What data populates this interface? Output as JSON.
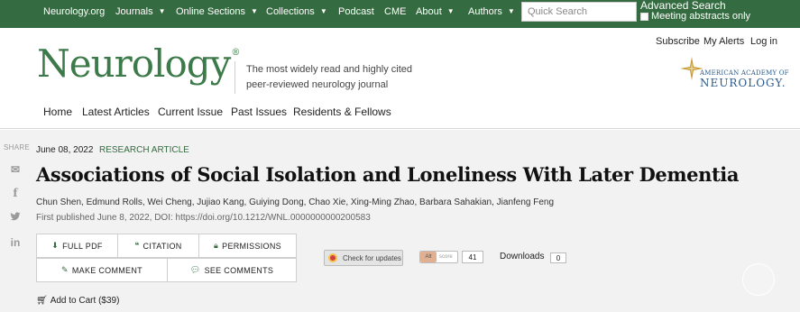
{
  "topnav": {
    "items": [
      {
        "label": "Neurology.org",
        "dropdown": false
      },
      {
        "label": "Journals",
        "dropdown": true
      },
      {
        "label": "Online Sections",
        "dropdown": true
      },
      {
        "label": "Collections",
        "dropdown": true
      },
      {
        "label": "Podcast",
        "dropdown": false
      },
      {
        "label": "CME",
        "dropdown": false
      },
      {
        "label": "About",
        "dropdown": true
      },
      {
        "label": "Authors",
        "dropdown": true
      }
    ],
    "search_placeholder": "Quick Search",
    "advanced_search": "Advanced Search",
    "meeting_abstracts": "Meeting abstracts only"
  },
  "account": {
    "subscribe": "Subscribe",
    "my_alerts": "My Alerts",
    "log_in": "Log in"
  },
  "brand": {
    "logo": "Neurology",
    "registered": "®",
    "tagline": "The most widely read and highly cited peer-reviewed neurology journal",
    "aan_line1": "AMERICAN ACADEMY OF",
    "aan_line2": "NEUROLOGY."
  },
  "subnav": [
    "Home",
    "Latest Articles",
    "Current Issue",
    "Past Issues",
    "Residents & Fellows"
  ],
  "share": {
    "label": "SHARE",
    "icons": [
      "email-icon",
      "facebook-icon",
      "twitter-icon",
      "linkedin-icon"
    ]
  },
  "article": {
    "date": "June 08, 2022",
    "type": "RESEARCH ARTICLE",
    "title": "Associations of Social Isolation and Loneliness With Later Dementia",
    "authors": "Chun Shen, Edmund Rolls, Wei Cheng, Jujiao Kang, Guiying Dong, Chao Xie, Xing-Ming Zhao, Barbara Sahakian, Jianfeng Feng",
    "published": "First published June 8, 2022, DOI: https://doi.org/10.1212/WNL.0000000000200583"
  },
  "actions": {
    "full_pdf": "FULL PDF",
    "citation": "CITATION",
    "permissions": "PERMISSIONS",
    "make_comment": "MAKE COMMENT",
    "see_comments": "SEE COMMENTS"
  },
  "metrics": {
    "check_updates": "Check for updates",
    "altmetric_label": "score",
    "altmetric_score": "41",
    "downloads_label": "Downloads",
    "downloads_count": "0"
  },
  "cart": "Add to Cart ($39)",
  "colors": {
    "brand_green": "#356b40",
    "logo_green": "#3d7a4a"
  }
}
